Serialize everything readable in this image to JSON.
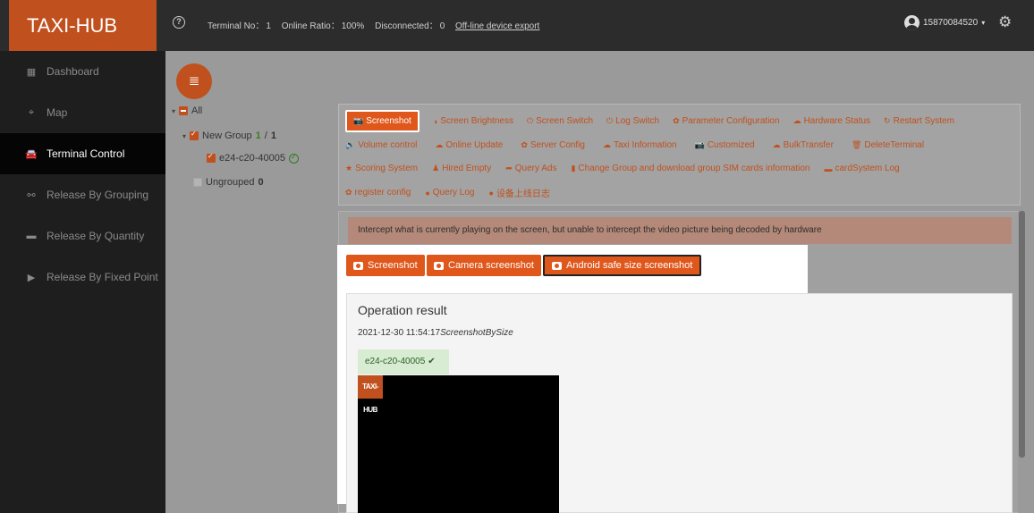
{
  "header": {
    "brand": "TAXI-HUB",
    "help_icon": "?",
    "terminal_label": "Terminal No：",
    "terminal_value": "1",
    "online_label": "Online Ratio：",
    "online_value": "100%",
    "disconnected_label": "Disconnected：",
    "disconnected_value": "0",
    "export_link": "Off-line device export",
    "username": "15870084520",
    "user_caret": "▾",
    "settings_icon": "⚙"
  },
  "sidebar": {
    "items": [
      {
        "label": "Dashboard",
        "icon": "▦",
        "icon_name": "dashboard-icon"
      },
      {
        "label": "Map",
        "icon": "⌖",
        "icon_name": "map-icon"
      },
      {
        "label": "Terminal Control",
        "icon": "🚘",
        "icon_name": "car-icon"
      },
      {
        "label": "Release By Grouping",
        "icon": "⚯",
        "icon_name": "group-icon"
      },
      {
        "label": "Release By Quantity",
        "icon": "▬",
        "icon_name": "quantity-icon"
      },
      {
        "label": "Release By Fixed Point",
        "icon": "▶",
        "icon_name": "play-icon"
      }
    ],
    "active_index": 2
  },
  "tree": {
    "fab_icon": "≣",
    "all_label": "All",
    "group_name": "New Group",
    "group_online": "1",
    "group_sep": "/",
    "group_total": "1",
    "device": "e24-c20-40005",
    "ungrouped_label": "Ungrouped",
    "ungrouped_count": "0"
  },
  "functions": {
    "row1": [
      "Screenshot",
      "Screen Brightness",
      "Screen Switch",
      "Log Switch",
      "Parameter Configuration",
      "Hardware Status",
      "Restart System"
    ],
    "row1_icons": [
      "📷",
      "◑",
      "⏻",
      "⏻",
      "✿",
      "☁",
      "↻"
    ],
    "row2": [
      "Volume control",
      "Online Update",
      "Server Config",
      "Taxi Information",
      "Customized",
      "BulkTransfer",
      "DeleteTerminal"
    ],
    "row2_icons": [
      "🔈",
      "☁",
      "✿",
      "☁",
      "📷",
      "☁",
      "🗑"
    ],
    "row3": [
      "Scoring System",
      "Hired Empty",
      "Query Ads",
      "Change Group and download group SIM cards information",
      "cardSystem Log"
    ],
    "row3_icons": [
      "★",
      "♟",
      "➦",
      "▮",
      "▬"
    ],
    "row4": [
      "register config",
      "Query Log",
      "设备上线日志"
    ],
    "row4_icons": [
      "✿",
      "●",
      "●"
    ],
    "active": "Screenshot"
  },
  "notice": "Intercept what is currently playing on the screen, but unable to intercept the video picture being decoded by hardware",
  "actions": {
    "screenshot": "Screenshot",
    "camera": "Camera screenshot",
    "android": "Android safe size screenshot"
  },
  "result": {
    "title": "Operation result",
    "timestamp": "2021-12-30 11:54:17",
    "method": "ScreenshotBySize",
    "device": "e24-c20-40005",
    "check": "✔",
    "logo_text": "TAXI-HUB"
  },
  "colors": {
    "accent": "#e0571b",
    "brand": "#c0501e",
    "sidebar_bg": "#1e1e1e",
    "notice_bg": "#b48979"
  }
}
